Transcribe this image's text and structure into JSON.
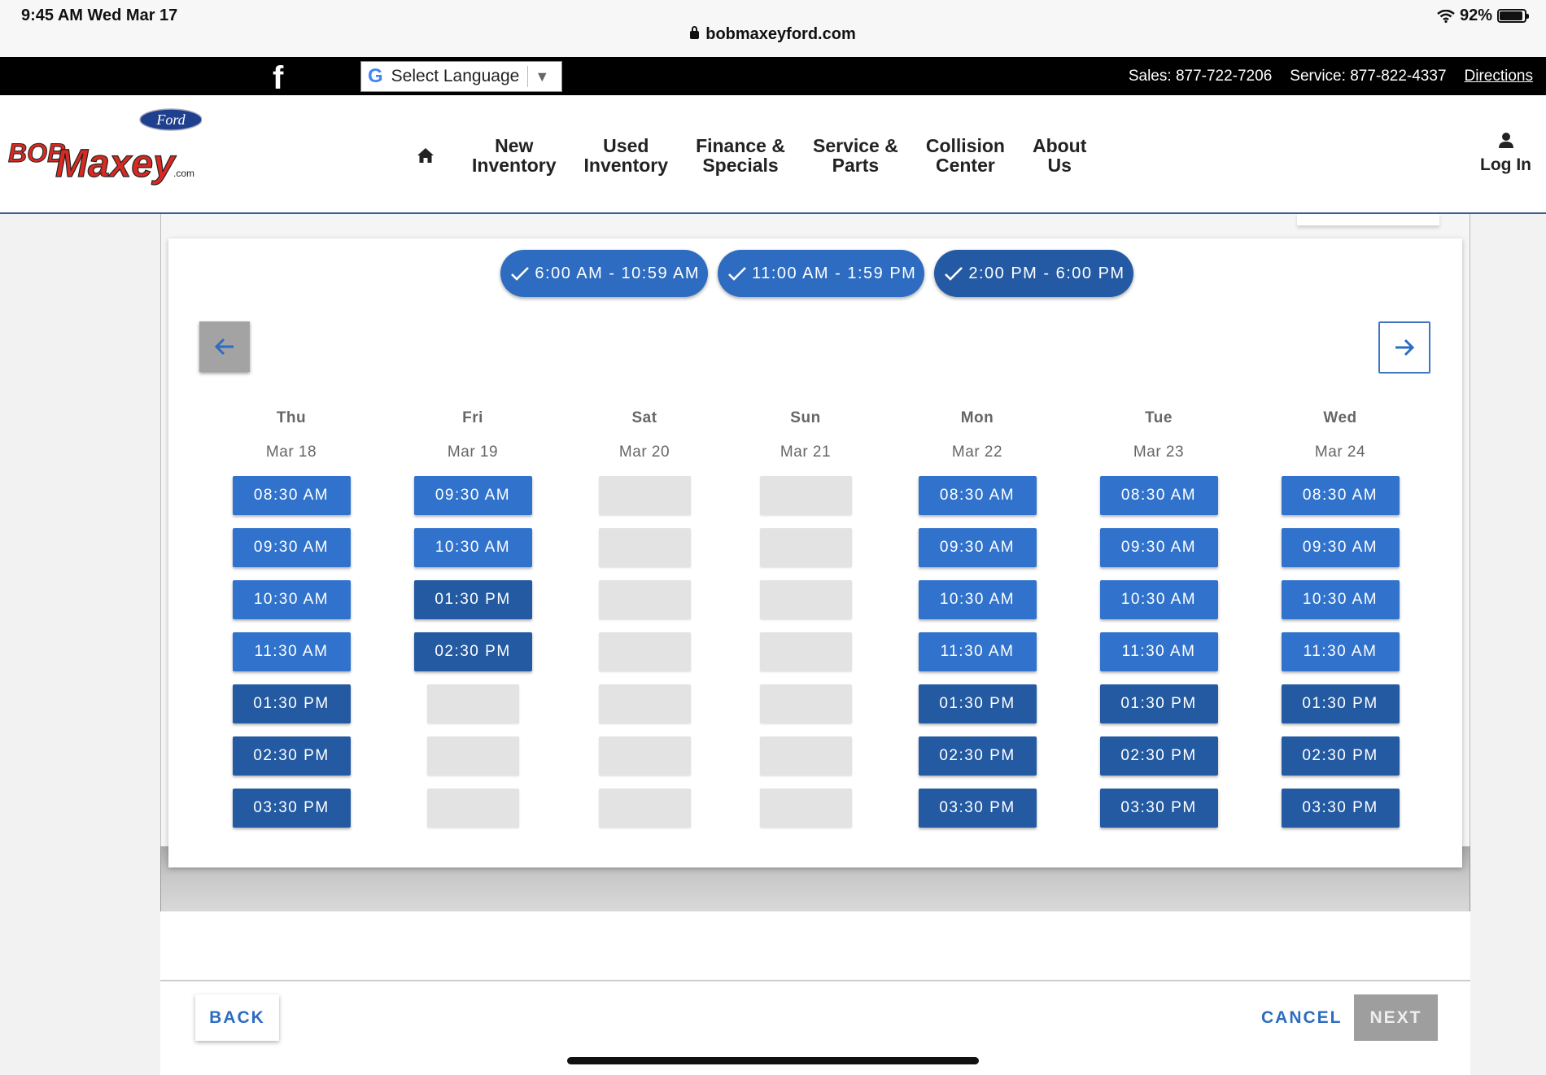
{
  "status_bar": {
    "time": "9:45 AM   Wed Mar 17",
    "url": "bobmaxeyford.com",
    "battery": "92%",
    "battery_level": 0.92
  },
  "top_bar": {
    "facebook_glyph": "f",
    "language_select": "Select Language",
    "sales_label": "Sales:",
    "sales_phone": "877-722-7206",
    "service_label": "Service:",
    "service_phone": "877-822-4337",
    "directions": "Directions"
  },
  "nav": {
    "brand_ford": "Ford",
    "brand_bob": "BOB",
    "brand_maxey": "Maxey",
    "brand_com": ".com",
    "items": [
      {
        "line1": "New",
        "line2": "Inventory"
      },
      {
        "line1": "Used",
        "line2": "Inventory"
      },
      {
        "line1": "Finance &",
        "line2": "Specials"
      },
      {
        "line1": "Service &",
        "line2": "Parts"
      },
      {
        "line1": "Collision",
        "line2": "Center"
      },
      {
        "line1": "About",
        "line2": "Us"
      }
    ],
    "login": "Log In"
  },
  "filters": [
    {
      "label": "6:00 AM - 10:59 AM",
      "checked": true
    },
    {
      "label": "11:00 AM - 1:59 PM",
      "checked": true
    },
    {
      "label": "2:00 PM - 6:00 PM",
      "checked": true
    }
  ],
  "days": [
    {
      "name": "Thu",
      "date": "Mar 18",
      "slots": [
        "08:30 AM",
        "09:30 AM",
        "10:30 AM",
        "11:30 AM",
        "01:30 PM",
        "02:30 PM",
        "03:30 PM"
      ]
    },
    {
      "name": "Fri",
      "date": "Mar 19",
      "slots": [
        "09:30 AM",
        "10:30 AM",
        "01:30 PM",
        "02:30 PM",
        "",
        "",
        ""
      ]
    },
    {
      "name": "Sat",
      "date": "Mar 20",
      "slots": [
        "",
        "",
        "",
        "",
        "",
        "",
        ""
      ]
    },
    {
      "name": "Sun",
      "date": "Mar 21",
      "slots": [
        "",
        "",
        "",
        "",
        "",
        "",
        ""
      ]
    },
    {
      "name": "Mon",
      "date": "Mar 22",
      "slots": [
        "08:30 AM",
        "09:30 AM",
        "10:30 AM",
        "11:30 AM",
        "01:30 PM",
        "02:30 PM",
        "03:30 PM"
      ]
    },
    {
      "name": "Tue",
      "date": "Mar 23",
      "slots": [
        "08:30 AM",
        "09:30 AM",
        "10:30 AM",
        "11:30 AM",
        "01:30 PM",
        "02:30 PM",
        "03:30 PM"
      ]
    },
    {
      "name": "Wed",
      "date": "Mar 24",
      "slots": [
        "08:30 AM",
        "09:30 AM",
        "10:30 AM",
        "11:30 AM",
        "01:30 PM",
        "02:30 PM",
        "03:30 PM"
      ]
    }
  ],
  "footer": {
    "back": "BACK",
    "cancel": "CANCEL",
    "next": "NEXT"
  },
  "colors": {
    "slot_am": "#3173cc",
    "slot_pm": "#245aa2",
    "slot_empty": "#e3e3e3",
    "accent": "#2d6cc0"
  }
}
